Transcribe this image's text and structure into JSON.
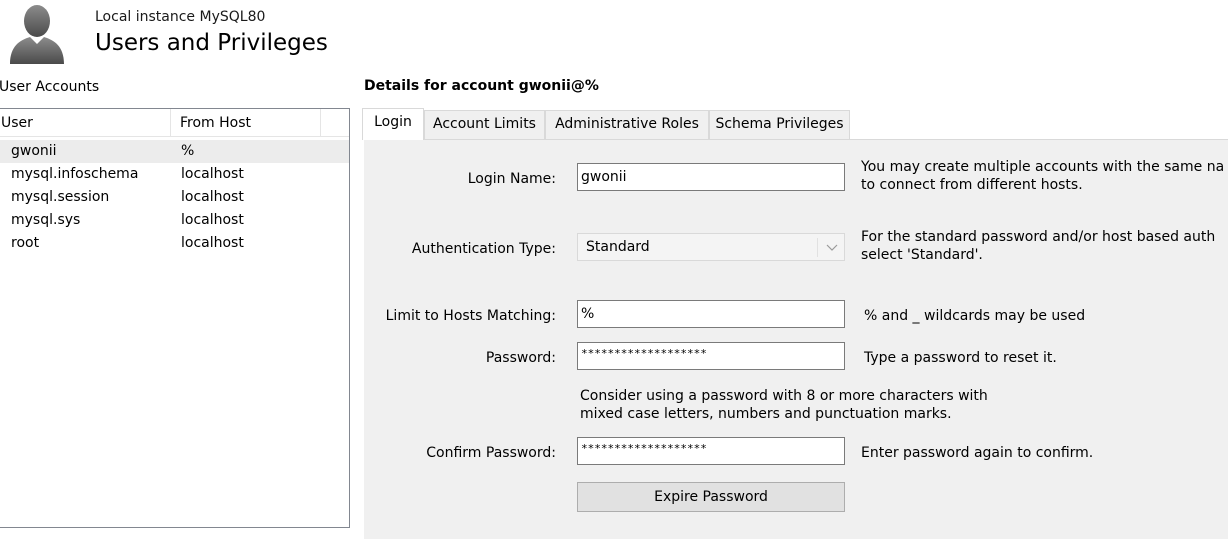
{
  "header": {
    "instance": "Local instance MySQL80",
    "title": "Users and Privileges",
    "avatar_icon": "user-silhouette-icon"
  },
  "accounts": {
    "heading": "User Accounts",
    "columns": [
      "User",
      "From Host"
    ],
    "rows": [
      {
        "user": "gwonii",
        "host": "%",
        "selected": true
      },
      {
        "user": "mysql.infoschema",
        "host": "localhost",
        "selected": false
      },
      {
        "user": "mysql.session",
        "host": "localhost",
        "selected": false
      },
      {
        "user": "mysql.sys",
        "host": "localhost",
        "selected": false
      },
      {
        "user": "root",
        "host": "localhost",
        "selected": false
      }
    ]
  },
  "details": {
    "heading": "Details for account gwonii@%",
    "tabs": [
      {
        "label": "Login",
        "active": true
      },
      {
        "label": "Account Limits",
        "active": false
      },
      {
        "label": "Administrative Roles",
        "active": false
      },
      {
        "label": "Schema Privileges",
        "active": false
      }
    ],
    "login": {
      "login_name_label": "Login Name:",
      "login_name_value": "gwonii",
      "login_name_hint_1": "You may create multiple accounts with the same na",
      "login_name_hint_2": "to connect from different hosts.",
      "auth_type_label": "Authentication Type:",
      "auth_type_value": "Standard",
      "auth_type_hint_1": "For the standard password and/or host based auth",
      "auth_type_hint_2": "select 'Standard'.",
      "hosts_label": "Limit to Hosts Matching:",
      "hosts_value": "%",
      "hosts_hint": "% and _ wildcards may be used",
      "password_label": "Password:",
      "password_value": "*******************",
      "password_hint": "Type a password to reset it.",
      "password_advice_1": "Consider using a password with 8 or more characters with",
      "password_advice_2": "mixed case letters, numbers and punctuation marks.",
      "confirm_label": "Confirm Password:",
      "confirm_value": "*******************",
      "confirm_hint": "Enter password again to confirm.",
      "expire_button": "Expire Password"
    }
  },
  "colors": {
    "window_bg": "#ffffff",
    "tab_content_bg": "#f0f0f0",
    "selected_row_bg": "#ececec",
    "input_border": "#7a7a7a",
    "button_bg": "#e1e1e1"
  }
}
